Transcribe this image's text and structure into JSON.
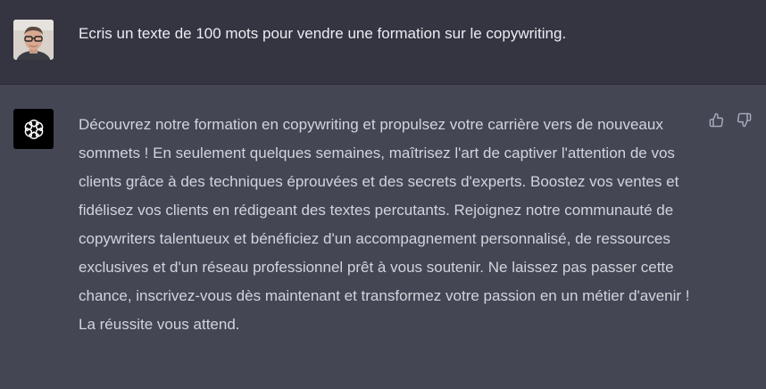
{
  "user_message": {
    "avatar_icon": "user-photo-avatar",
    "text": "Ecris un texte de 100 mots pour vendre une formation sur le copywriting."
  },
  "assistant_message": {
    "avatar_icon": "openai-logo-icon",
    "text": "Découvrez notre formation en copywriting et propulsez votre carrière vers de nouveaux sommets ! En seulement quelques semaines, maîtrisez l'art de captiver l'attention de vos clients grâce à des techniques éprouvées et des secrets d'experts. Boostez vos ventes et fidélisez vos clients en rédigeant des textes percutants. Rejoignez notre communauté de copywriters talentueux et bénéficiez d'un accompagnement personnalisé, de ressources exclusives et d'un réseau professionnel prêt à vous soutenir. Ne laissez pas passer cette chance, inscrivez-vous dès maintenant et transformez votre passion en un métier d'avenir ! La réussite vous attend.",
    "actions": [
      {
        "icon": "thumbs-up-icon"
      },
      {
        "icon": "thumbs-down-icon"
      }
    ]
  },
  "colors": {
    "user_row_bg": "#343541",
    "assistant_row_bg": "#444654",
    "text_primary": "#ececf1",
    "text_secondary": "#d1d5db",
    "icon_gray": "#acacbe"
  }
}
